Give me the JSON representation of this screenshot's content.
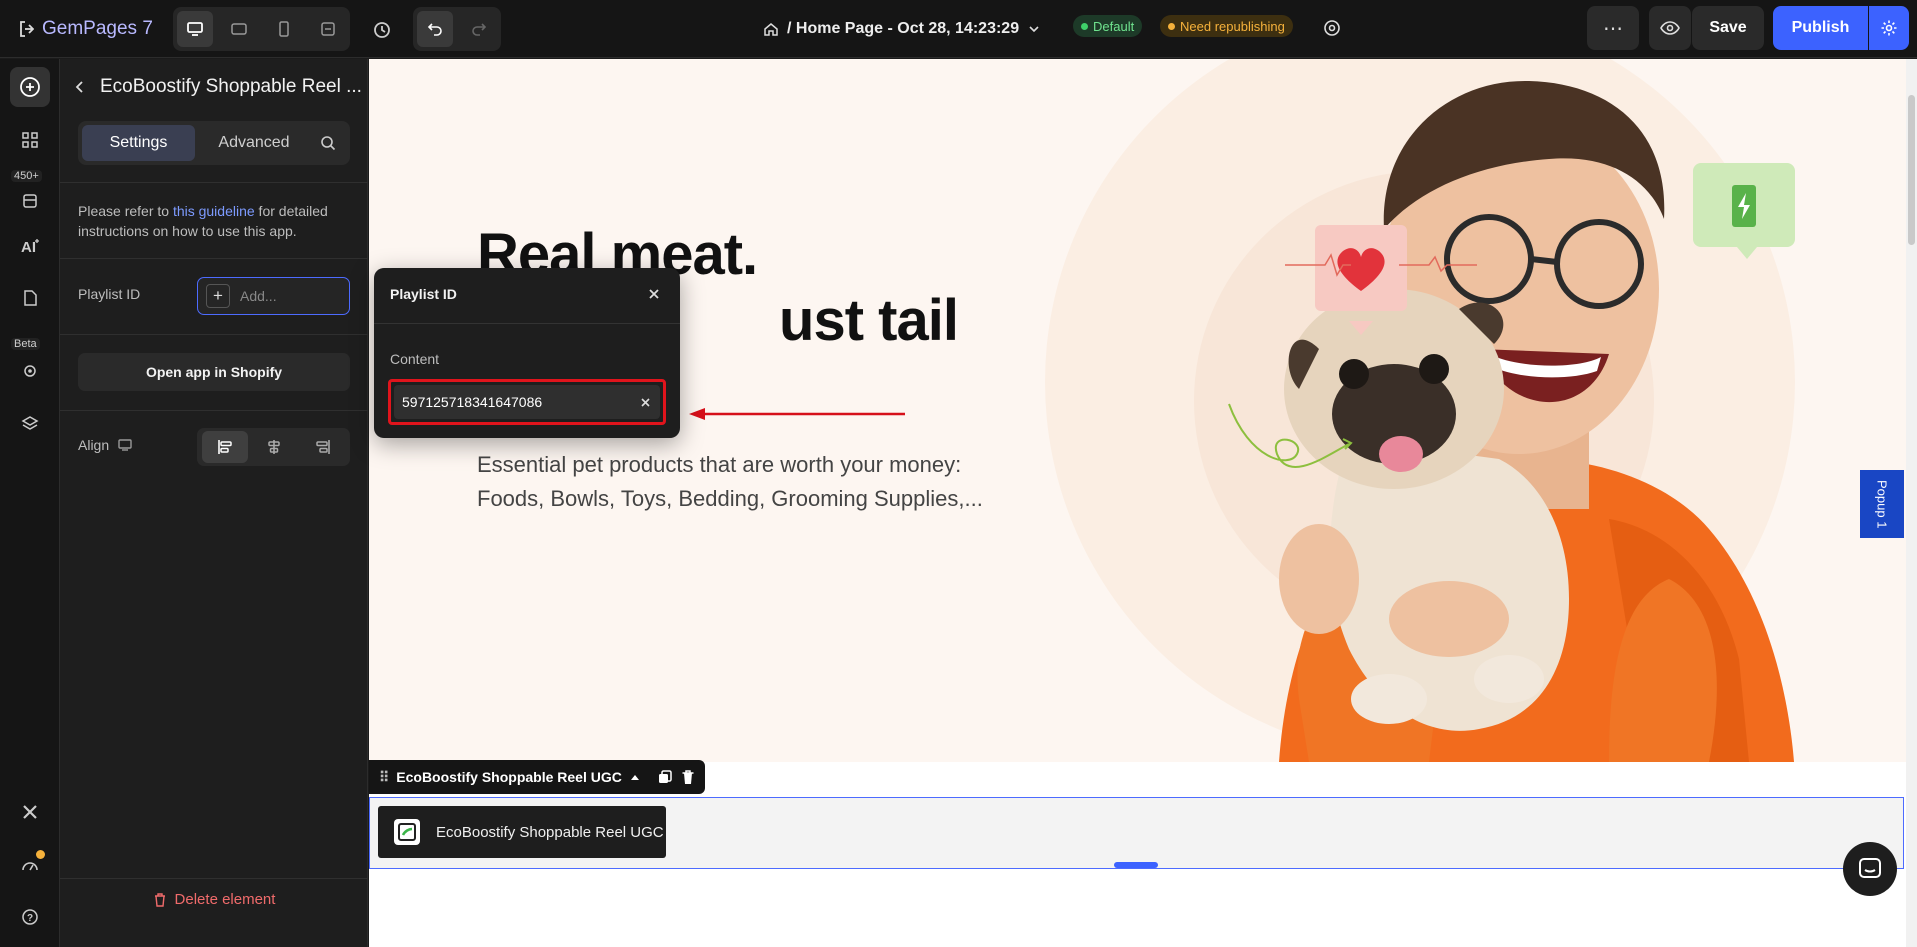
{
  "app": {
    "name": "GemPages 7"
  },
  "topbar": {
    "page_title": "/ Home Page - Oct 28, 14:23:29",
    "badge_default": "Default",
    "badge_warning": "Need republishing",
    "more_label": "⋯",
    "save_label": "Save",
    "publish_label": "Publish"
  },
  "rail": {
    "badge_count": "450+",
    "beta_label": "Beta"
  },
  "panel": {
    "title": "EcoBoostify Shoppable Reel ...",
    "tabs": [
      {
        "label": "Settings"
      },
      {
        "label": "Advanced"
      }
    ],
    "guide_prefix": "Please refer to ",
    "guide_link": "this guideline",
    "guide_suffix": " for detailed instructions on how to use this app.",
    "playlist_label": "Playlist ID",
    "playlist_placeholder": "Add...",
    "open_app_label": "Open app in Shopify",
    "align_label": "Align",
    "delete_label": "Delete element"
  },
  "popover": {
    "title": "Playlist ID",
    "content_label": "Content",
    "content_value": "597125718341647086"
  },
  "canvas": {
    "headline": "Real meat. No               ust tail",
    "subhead_line1": "Essential pet products that are worth your money:",
    "subhead_line2": "Foods, Bowls, Toys, Bedding, Grooming Supplies,...",
    "popup_tab": "Popup 1",
    "element_toolbar_label": "EcoBoostify Shoppable Reel UGC",
    "element_chip_label": "EcoBoostify Shoppable Reel UGC"
  },
  "colors": {
    "accent": "#3c62ff",
    "highlight_red": "#e0141c",
    "hero_bg": "#fdf6f1"
  }
}
